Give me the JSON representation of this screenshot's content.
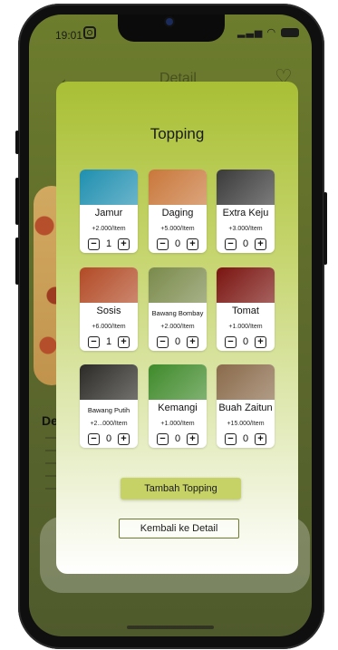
{
  "status": {
    "time": "19:01",
    "signal": "..ll"
  },
  "background": {
    "header_title": "Detail",
    "item_title": "De"
  },
  "modal": {
    "title": "Topping",
    "toppings": [
      {
        "name": "Jamur",
        "price": "+2.000/Item",
        "qty": "1",
        "icon": "mushroom-image",
        "color": "#1f8fb0"
      },
      {
        "name": "Daging",
        "price": "+5.000/Item",
        "qty": "0",
        "icon": "meat-image",
        "color": "#c9773a"
      },
      {
        "name": "Extra Keju",
        "price": "+3.000/Item",
        "qty": "0",
        "icon": "cheese-image",
        "color": "#3a3a3a"
      },
      {
        "name": "Sosis",
        "price": "+6.000/Item",
        "qty": "1",
        "icon": "sausage-image",
        "color": "#b24a25"
      },
      {
        "name": "Bawang Bombay",
        "price": "+2.000/Item",
        "qty": "0",
        "icon": "onion-image",
        "color": "#7a8a4b"
      },
      {
        "name": "Tomat",
        "price": "+1.000/Item",
        "qty": "0",
        "icon": "tomato-image",
        "color": "#7a1410"
      },
      {
        "name": "Bawang Putih",
        "price": "+2...000/Item",
        "qty": "0",
        "icon": "garlic-image",
        "color": "#2b2a26"
      },
      {
        "name": "Kemangi",
        "price": "+1.000/Item",
        "qty": "0",
        "icon": "basil-image",
        "color": "#3f8a2a"
      },
      {
        "name": "Buah Zaitun",
        "price": "+15.000/Item",
        "qty": "0",
        "icon": "olive-image",
        "color": "#8a6a4a"
      }
    ],
    "minus": "−",
    "plus": "+",
    "add_label": "Tambah Topping",
    "back_label": "Kembali ke Detail"
  }
}
